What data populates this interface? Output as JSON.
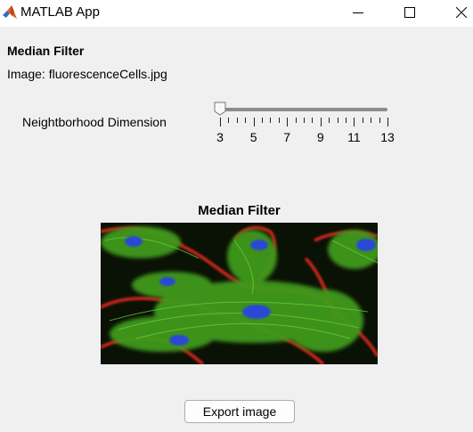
{
  "window": {
    "title": "MATLAB App"
  },
  "panel": {
    "heading": "Median Filter",
    "filename": "Image: fluorescenceCells.jpg"
  },
  "slider": {
    "label": "Neightborhood Dimension",
    "min": 3,
    "max": 13,
    "value": 3,
    "tick_labels": [
      "3",
      "5",
      "7",
      "9",
      "11",
      "13"
    ]
  },
  "image_axes": {
    "title": "Median Filter"
  },
  "buttons": {
    "export": "Export image"
  },
  "colors": {
    "window_bg": "#f0f0f0",
    "titlebar_bg": "#ffffff",
    "slider_track": "#8c8c8c"
  },
  "icons": [
    "matlab-logo-icon",
    "minimize-icon",
    "maximize-icon",
    "close-icon"
  ]
}
